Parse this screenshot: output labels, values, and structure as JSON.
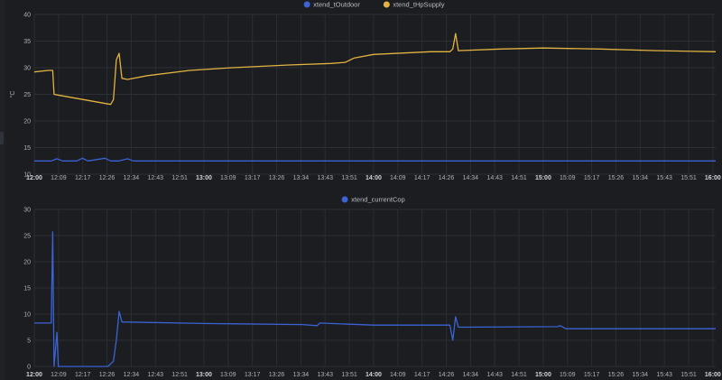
{
  "x_ticks": [
    "12:00",
    "12:09",
    "12:17",
    "12:26",
    "12:34",
    "12:43",
    "12:51",
    "13:00",
    "13:09",
    "13:17",
    "13:26",
    "13:34",
    "13:43",
    "13:51",
    "14:00",
    "14:09",
    "14:17",
    "14:26",
    "14:34",
    "14:43",
    "14:51",
    "15:00",
    "15:09",
    "15:17",
    "15:26",
    "15:34",
    "15:43",
    "15:51",
    "16:00"
  ],
  "x_ticks_bold": [
    "12:00",
    "13:00",
    "14:00",
    "15:00",
    "16:00"
  ],
  "chart_data": [
    {
      "type": "line",
      "ylabel": "°C",
      "ylim": [
        10,
        40
      ],
      "y_ticks": [
        "10",
        "15",
        "20",
        "25",
        "30",
        "35",
        "40"
      ],
      "xlim_minutes": [
        0,
        241
      ],
      "legend_placement": "top-center",
      "grid": true,
      "series": [
        {
          "name": "xtend_tOutdoor",
          "color": "#3b63d4",
          "points": [
            [
              0,
              12.5
            ],
            [
              6,
              12.5
            ],
            [
              8,
              12.9
            ],
            [
              10,
              12.5
            ],
            [
              15,
              12.5
            ],
            [
              17,
              13
            ],
            [
              19,
              12.5
            ],
            [
              25,
              13
            ],
            [
              27,
              12.5
            ],
            [
              30,
              12.5
            ],
            [
              33,
              12.9
            ],
            [
              35,
              12.5
            ],
            [
              241,
              12.5
            ]
          ]
        },
        {
          "name": "xtend_tHpSupply",
          "color": "#e3b341",
          "points": [
            [
              0,
              29.2
            ],
            [
              5,
              29.5
            ],
            [
              6.5,
              29.5
            ],
            [
              7,
              25
            ],
            [
              9,
              24.8
            ],
            [
              27,
              23.1
            ],
            [
              28,
              24
            ],
            [
              29,
              31.5
            ],
            [
              30,
              32.7
            ],
            [
              31,
              28
            ],
            [
              33,
              27.8
            ],
            [
              40,
              28.5
            ],
            [
              55,
              29.5
            ],
            [
              70,
              30
            ],
            [
              90,
              30.5
            ],
            [
              105,
              30.8
            ],
            [
              110,
              31
            ],
            [
              113,
              31.8
            ],
            [
              120,
              32.5
            ],
            [
              140,
              33
            ],
            [
              147,
              33
            ],
            [
              148,
              33.5
            ],
            [
              149,
              36.4
            ],
            [
              150,
              33.2
            ],
            [
              165,
              33.5
            ],
            [
              180,
              33.7
            ],
            [
              200,
              33.5
            ],
            [
              220,
              33.2
            ],
            [
              241,
              33
            ]
          ]
        }
      ]
    },
    {
      "type": "line",
      "ylim": [
        0,
        30
      ],
      "y_ticks": [
        "0",
        "5",
        "10",
        "15",
        "20",
        "25",
        "30"
      ],
      "xlim_minutes": [
        0,
        241
      ],
      "legend_placement": "top-center",
      "grid": true,
      "series": [
        {
          "name": "xtend_currentCop",
          "color": "#3b63d4",
          "points": [
            [
              0,
              8.3
            ],
            [
              6,
              8.3
            ],
            [
              6.5,
              25.7
            ],
            [
              7,
              0
            ],
            [
              8,
              6.5
            ],
            [
              8.5,
              0
            ],
            [
              26,
              0
            ],
            [
              28,
              1
            ],
            [
              29,
              5
            ],
            [
              30,
              10.5
            ],
            [
              31,
              8.5
            ],
            [
              60,
              8.2
            ],
            [
              95,
              8.0
            ],
            [
              100,
              7.8
            ],
            [
              101,
              8.3
            ],
            [
              120,
              7.9
            ],
            [
              147,
              7.9
            ],
            [
              148,
              5
            ],
            [
              149,
              9.5
            ],
            [
              150,
              7.5
            ],
            [
              185,
              7.6
            ],
            [
              186,
              7.8
            ],
            [
              188,
              7.2
            ],
            [
              241,
              7.2
            ]
          ]
        }
      ]
    }
  ]
}
